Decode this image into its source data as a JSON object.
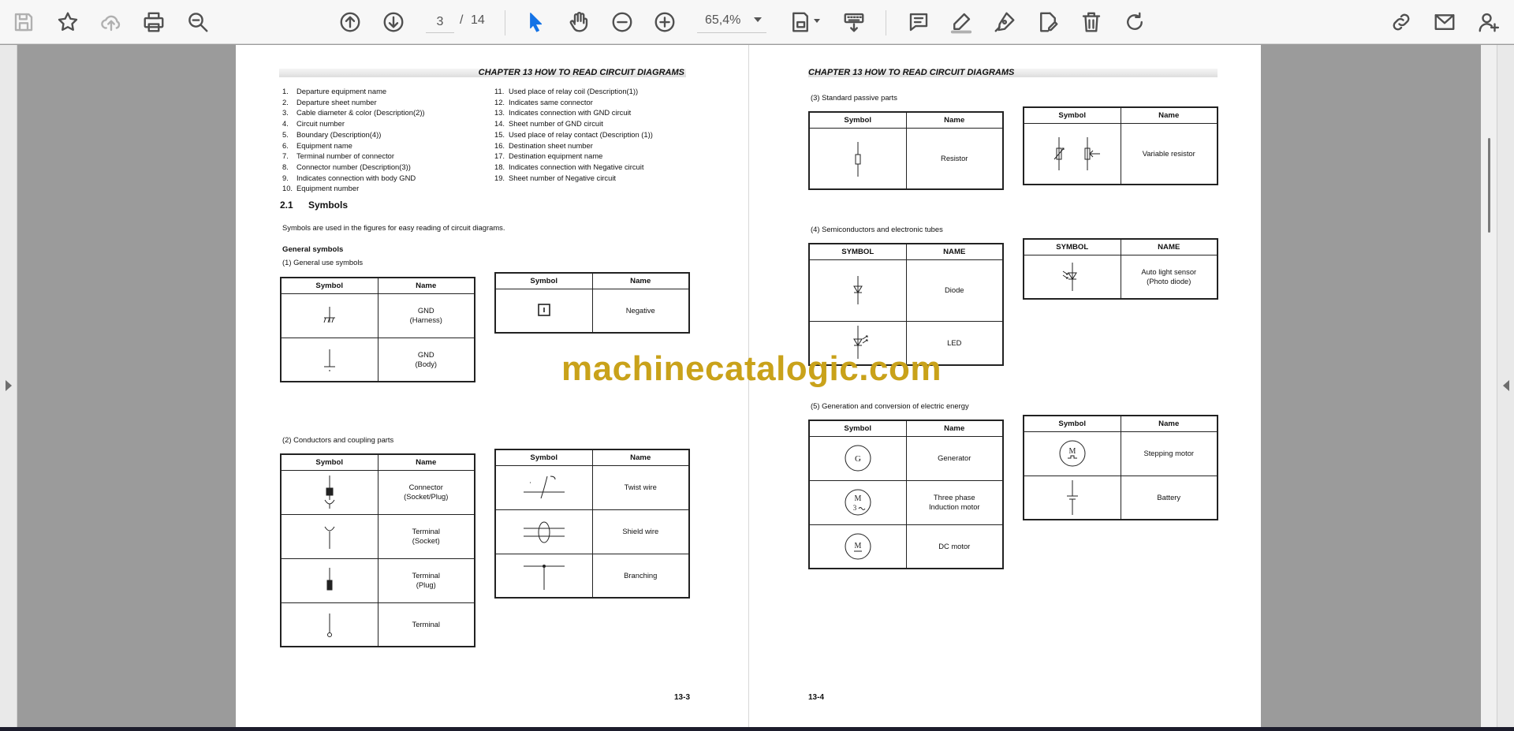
{
  "toolbar": {
    "current_page": "3",
    "page_separator": "/",
    "total_pages": "14",
    "zoom": "65,4%"
  },
  "watermark": "machinecatalogic.com",
  "left_page": {
    "chapter_header": "CHAPTER 13 HOW TO READ CIRCUIT DIAGRAMS",
    "legend_col1": [
      {
        "n": "1.",
        "t": "Departure equipment name"
      },
      {
        "n": "2.",
        "t": "Departure sheet number"
      },
      {
        "n": "3.",
        "t": "Cable diameter & color (Description(2))"
      },
      {
        "n": "4.",
        "t": "Circuit number"
      },
      {
        "n": "5.",
        "t": "Boundary (Description(4))"
      },
      {
        "n": "6.",
        "t": "Equipment name"
      },
      {
        "n": "7.",
        "t": "Terminal number of connector"
      },
      {
        "n": "8.",
        "t": "Connector number (Description(3))"
      },
      {
        "n": "9.",
        "t": "Indicates connection with body GND"
      },
      {
        "n": "10.",
        "t": "Equipment number"
      }
    ],
    "legend_col2": [
      {
        "n": "11.",
        "t": "Used place of relay coil (Description(1))"
      },
      {
        "n": "12.",
        "t": "Indicates same connector"
      },
      {
        "n": "13.",
        "t": "Indicates connection with GND circuit"
      },
      {
        "n": "14.",
        "t": "Sheet number of GND circuit"
      },
      {
        "n": "15.",
        "t": "Used place of relay contact (Description (1))"
      },
      {
        "n": "16.",
        "t": "Destination sheet number"
      },
      {
        "n": "17.",
        "t": "Destination equipment name"
      },
      {
        "n": "18.",
        "t": "Indicates connection with Negative circuit"
      },
      {
        "n": "19.",
        "t": "Sheet number of Negative circuit"
      }
    ],
    "section_number": "2.1",
    "section_title": "Symbols",
    "intro": "Symbols are used in the figures for easy reading of circuit diagrams.",
    "general_symbols": "General symbols",
    "sub1": "(1)   General use symbols",
    "sub2": "(2)   Conductors and coupling parts",
    "page_number": "13-3",
    "table_a": {
      "h1": "Symbol",
      "h2": "Name",
      "rows": [
        {
          "icon": "gnd-harness-icon",
          "name": "GND\n(Harness)"
        },
        {
          "icon": "gnd-body-icon",
          "name": "GND\n(Body)"
        }
      ]
    },
    "table_b": {
      "h1": "Symbol",
      "h2": "Name",
      "rows": [
        {
          "icon": "negative-icon",
          "name": "Negative"
        }
      ]
    },
    "table_c": {
      "h1": "Symbol",
      "h2": "Name",
      "rows": [
        {
          "icon": "connector-icon",
          "name": "Connector\n(Socket/Plug)"
        },
        {
          "icon": "terminal-socket-icon",
          "name": "Terminal\n(Socket)"
        },
        {
          "icon": "terminal-plug-icon",
          "name": "Terminal\n(Plug)"
        },
        {
          "icon": "terminal-icon",
          "name": "Terminal"
        }
      ]
    },
    "table_d": {
      "h1": "Symbol",
      "h2": "Name",
      "rows": [
        {
          "icon": "twist-wire-icon",
          "name": "Twist wire"
        },
        {
          "icon": "shield-wire-icon",
          "name": "Shield wire"
        },
        {
          "icon": "branching-icon",
          "name": "Branching"
        }
      ]
    }
  },
  "right_page": {
    "chapter_header": "CHAPTER 13 HOW TO READ CIRCUIT DIAGRAMS",
    "sub3": "(3)   Standard passive parts",
    "sub4": "(4)   Semiconductors and electronic tubes",
    "sub5": "(5)   Generation and conversion of electric energy",
    "page_number": "13-4",
    "table_e": {
      "h1": "Symbol",
      "h2": "Name",
      "rows": [
        {
          "icon": "resistor-icon",
          "name": "Resistor"
        }
      ]
    },
    "table_f": {
      "h1": "Symbol",
      "h2": "Name",
      "rows": [
        {
          "icon": "variable-resistor-icon",
          "name": "Variable resistor"
        }
      ]
    },
    "table_g": {
      "h1": "SYMBOL",
      "h2": "NAME",
      "rows": [
        {
          "icon": "diode-icon",
          "name": "Diode"
        },
        {
          "icon": "led-icon",
          "name": "LED"
        }
      ]
    },
    "table_h": {
      "h1": "SYMBOL",
      "h2": "NAME",
      "rows": [
        {
          "icon": "photo-diode-icon",
          "name": "Auto light sensor\n(Photo diode)"
        }
      ]
    },
    "table_i": {
      "h1": "Symbol",
      "h2": "Name",
      "rows": [
        {
          "icon": "generator-icon",
          "name": "Generator",
          "glyph": "G"
        },
        {
          "icon": "induction-motor-icon",
          "name": "Three phase\nInduction motor",
          "glyph": "M",
          "glyph2": "3"
        },
        {
          "icon": "dc-motor-icon",
          "name": "DC motor",
          "glyph": "M"
        }
      ]
    },
    "table_j": {
      "h1": "Symbol",
      "h2": "Name",
      "rows": [
        {
          "icon": "stepping-motor-icon",
          "name": "Stepping motor",
          "glyph": "M"
        },
        {
          "icon": "battery-icon",
          "name": "Battery"
        }
      ]
    }
  }
}
